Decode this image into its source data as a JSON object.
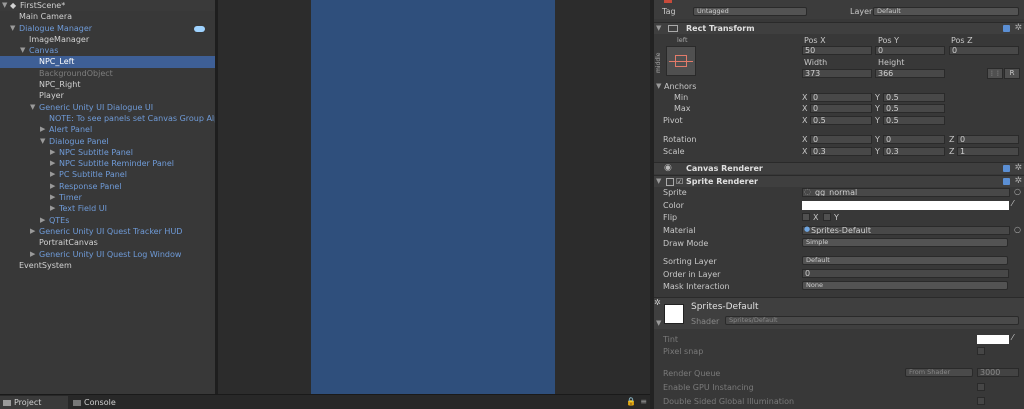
{
  "hierarchy": {
    "scene_name": "FirstScene*",
    "items": [
      {
        "label": "Main Camera",
        "depth": 1,
        "arrow": "",
        "style": "white"
      },
      {
        "label": "Dialogue Manager",
        "depth": 1,
        "arrow": "▼",
        "style": "blue"
      },
      {
        "label": "ImageManager",
        "depth": 2,
        "arrow": "",
        "style": "white"
      },
      {
        "label": "Canvas",
        "depth": 2,
        "arrow": "▼",
        "style": "blue"
      },
      {
        "label": "NPC_Left",
        "depth": 3,
        "arrow": "",
        "style": "sel"
      },
      {
        "label": "BackgroundObject",
        "depth": 3,
        "arrow": "",
        "style": "gray"
      },
      {
        "label": "NPC_Right",
        "depth": 3,
        "arrow": "",
        "style": "white"
      },
      {
        "label": "Player",
        "depth": 3,
        "arrow": "",
        "style": "white"
      },
      {
        "label": "Generic Unity UI Dialogue UI",
        "depth": 3,
        "arrow": "▼",
        "style": "blue"
      },
      {
        "label": "NOTE: To see panels set Canvas Group Alpha",
        "depth": 4,
        "arrow": "",
        "style": "blue"
      },
      {
        "label": "Alert Panel",
        "depth": 4,
        "arrow": "▶",
        "style": "blue"
      },
      {
        "label": "Dialogue Panel",
        "depth": 4,
        "arrow": "▼",
        "style": "blue"
      },
      {
        "label": "NPC Subtitle Panel",
        "depth": 5,
        "arrow": "▶",
        "style": "blue"
      },
      {
        "label": "NPC Subtitle Reminder Panel",
        "depth": 5,
        "arrow": "▶",
        "style": "blue"
      },
      {
        "label": "PC Subtitle Panel",
        "depth": 5,
        "arrow": "▶",
        "style": "blue"
      },
      {
        "label": "Response Panel",
        "depth": 5,
        "arrow": "▶",
        "style": "blue"
      },
      {
        "label": "Timer",
        "depth": 5,
        "arrow": "▶",
        "style": "blue"
      },
      {
        "label": "Text Field UI",
        "depth": 5,
        "arrow": "▶",
        "style": "blue"
      },
      {
        "label": "QTEs",
        "depth": 4,
        "arrow": "▶",
        "style": "blue"
      },
      {
        "label": "Generic Unity UI Quest Tracker HUD",
        "depth": 3,
        "arrow": "▶",
        "style": "blue"
      },
      {
        "label": "PortraitCanvas",
        "depth": 3,
        "arrow": "",
        "style": "white"
      },
      {
        "label": "Generic Unity UI Quest Log Window",
        "depth": 3,
        "arrow": "▶",
        "style": "blue"
      },
      {
        "label": "EventSystem",
        "depth": 1,
        "arrow": "",
        "style": "white"
      }
    ]
  },
  "bottom_tabs": {
    "project": "Project",
    "console": "Console"
  },
  "inspector": {
    "tag_label": "Tag",
    "tag_value": "Untagged",
    "layer_label": "Layer",
    "layer_value": "Default",
    "rect_transform": {
      "title": "Rect Transform",
      "anchor_top": "left",
      "anchor_side": "middle",
      "posx_label": "Pos X",
      "posy_label": "Pos Y",
      "posz_label": "Pos Z",
      "posx": "50",
      "posy": "0",
      "posz": "0",
      "width_label": "Width",
      "height_label": "Height",
      "width": "373",
      "height": "366",
      "r_button": "R",
      "anchors_label": "Anchors",
      "min_label": "Min",
      "max_label": "Max",
      "min_x": "0",
      "min_y": "0.5",
      "max_x": "0",
      "max_y": "0.5",
      "pivot_label": "Pivot",
      "pivot_x": "0.5",
      "pivot_y": "0.5",
      "rotation_label": "Rotation",
      "rot_x": "0",
      "rot_y": "0",
      "rot_z": "0",
      "scale_label": "Scale",
      "scale_x": "0.3",
      "scale_y": "0.3",
      "scale_z": "1",
      "x": "X",
      "y": "Y",
      "z": "Z"
    },
    "canvas_renderer": {
      "title": "Canvas Renderer"
    },
    "sprite_renderer": {
      "title": "Sprite Renderer",
      "sprite_label": "Sprite",
      "sprite_value": "gg_normal",
      "color_label": "Color",
      "flip_label": "Flip",
      "flip_x": "X",
      "flip_y": "Y",
      "material_label": "Material",
      "material_value": "Sprites-Default",
      "draw_mode_label": "Draw Mode",
      "draw_mode_value": "Simple",
      "sorting_layer_label": "Sorting Layer",
      "sorting_layer_value": "Default",
      "order_label": "Order in Layer",
      "order_value": "0",
      "mask_label": "Mask Interaction",
      "mask_value": "None"
    },
    "material": {
      "title": "Sprites-Default",
      "shader_label": "Shader",
      "shader_value": "Sprites/Default",
      "tint_label": "Tint",
      "pixel_snap_label": "Pixel snap",
      "render_queue_label": "Render Queue",
      "render_queue_mode": "From Shader",
      "render_queue_value": "3000",
      "gpu_label": "Enable GPU Instancing",
      "dsgi_label": "Double Sided Global Illumination"
    }
  },
  "colors": {
    "selection": "#3e5f96",
    "prefab_blue": "#6f9bd8",
    "panel": "#2f4f7c"
  }
}
